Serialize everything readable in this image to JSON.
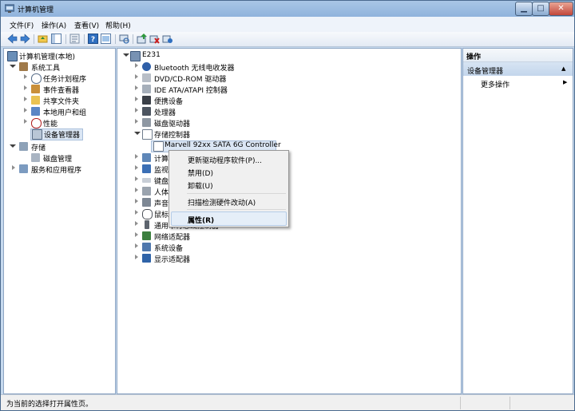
{
  "window": {
    "title": "计算机管理",
    "minimize": "▁",
    "maximize": "□",
    "close": "✕"
  },
  "menu": [
    "文件(F)",
    "操作(A)",
    "查看(V)",
    "帮助(H)"
  ],
  "left_tree": {
    "root": "计算机管理(本地)",
    "system_tools": "系统工具",
    "task_scheduler": "任务计划程序",
    "event_viewer": "事件查看器",
    "shared_folders": "共享文件夹",
    "local_users": "本地用户和组",
    "performance": "性能",
    "device_manager": "设备管理器",
    "storage": "存储",
    "disk_management": "磁盘管理",
    "services_apps": "服务和应用程序"
  },
  "device_tree": {
    "computer": "E231",
    "bluetooth": "Bluetooth 无线电收发器",
    "dvd": "DVD/CD-ROM 驱动器",
    "ide": "IDE ATA/ATAPI 控制器",
    "portable": "便携设备",
    "processor": "处理器",
    "disk": "磁盘驱动器",
    "storage_ctrl": "存储控制器",
    "marvell": "Marvell 92xx SATA 6G Controller",
    "computer_cat": "计算",
    "monitor": "监视",
    "keyboard": "键盘",
    "hid": "人体",
    "sound": "声音",
    "mouse": "鼠标",
    "usb": "通用串行总线控制器",
    "network": "网络适配器",
    "system_devices": "系统设备",
    "display": "显示适配器"
  },
  "context_menu": {
    "update_driver": "更新驱动程序软件(P)...",
    "disable": "禁用(D)",
    "uninstall": "卸载(U)",
    "scan": "扫描检测硬件改动(A)",
    "properties": "属性(R)"
  },
  "actions": {
    "title": "操作",
    "header": "设备管理器",
    "header_arrow": "▲",
    "more": "更多操作",
    "more_arrow": "▶"
  },
  "status": {
    "text": "为当前的选择打开属性页。"
  }
}
